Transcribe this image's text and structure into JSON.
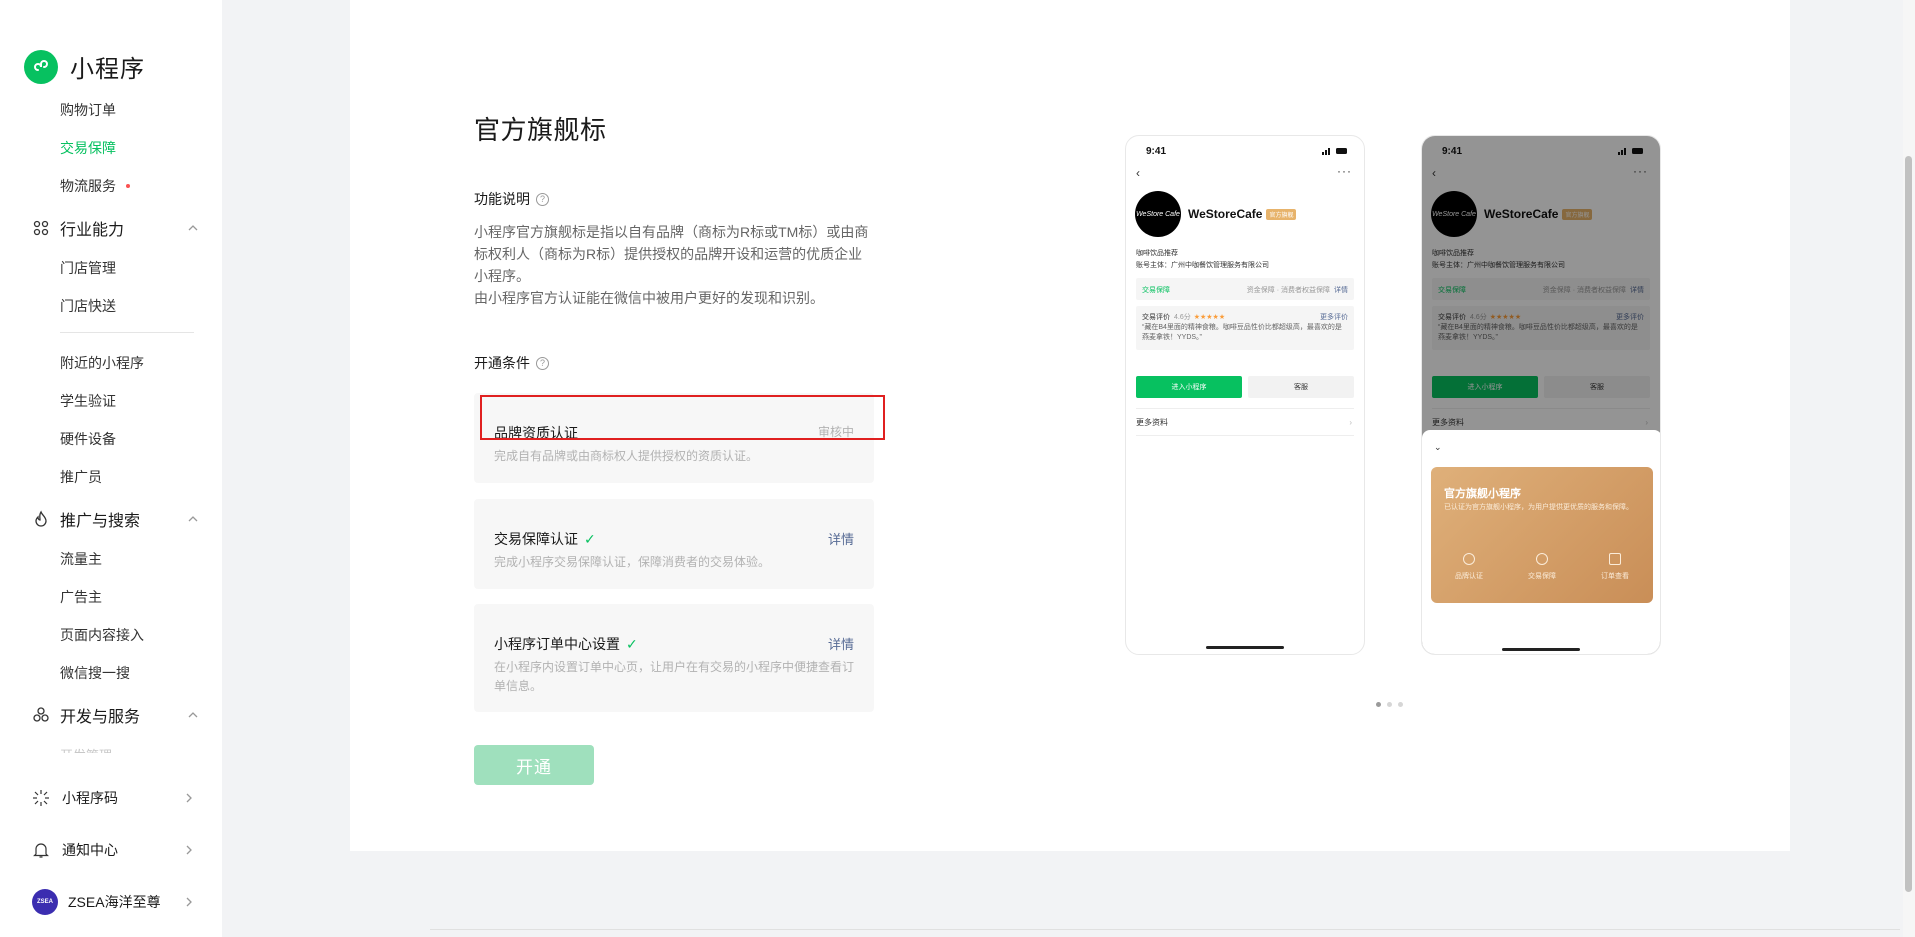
{
  "brand": {
    "title": "小程序"
  },
  "sidebar": {
    "top_items": [
      {
        "label": "购物订单",
        "active": false
      },
      {
        "label": "交易保障",
        "active": true
      },
      {
        "label": "物流服务",
        "active": false,
        "dot": true
      }
    ],
    "group_industry": {
      "label": "行业能力",
      "items": [
        "门店管理",
        "门店快送",
        "附近的小程序",
        "学生验证",
        "硬件设备",
        "推广员"
      ]
    },
    "group_promo": {
      "label": "推广与搜索",
      "items": [
        "流量主",
        "广告主",
        "页面内容接入",
        "微信搜一搜"
      ]
    },
    "group_dev": {
      "label": "开发与服务",
      "faded_item": "开发管理"
    },
    "bottom": {
      "qrcode": "小程序码",
      "notify": "通知中心",
      "account": "ZSEA海洋至尊",
      "avatar_text": "ZSEA"
    }
  },
  "main": {
    "title": "官方旗舰标",
    "feature_label": "功能说明",
    "feature_desc": [
      "小程序官方旗舰标是指以自有品牌（商标为R标或TM标）或由商标权利人（商标为R标）提供授权的品牌开设和运营的优质企业小程序。",
      "由小程序官方认证能在微信中被用户更好的发现和识别。"
    ],
    "conditions_label": "开通条件",
    "conditions": [
      {
        "title": "品牌资质认证",
        "status": "审核中",
        "desc": "完成自有品牌或由商标权人提供授权的资质认证。"
      },
      {
        "title": "交易保障认证",
        "check": "✓",
        "link": "详情",
        "desc": "完成小程序交易保障认证，保障消费者的交易体验。"
      },
      {
        "title": "小程序订单中心设置",
        "check": "✓",
        "link": "详情",
        "desc": "在小程序内设置订单中心页，让用户在有交易的小程序中便捷查看订单信息。"
      }
    ],
    "open_button": "开通"
  },
  "phone": {
    "time": "9:41",
    "name": "WeStoreCafe",
    "tag": "官方旗舰",
    "logo_text": "WeStore Cafe",
    "category": "咖啡饮品推荐",
    "owner": "账号主体：广州中咖餐饮管理服务有限公司",
    "guard_left": "交易保障",
    "guard_right": "资金保障 · 消费者权益保障",
    "guard_link": "详情",
    "review_label": "交易评价",
    "review_score": "4.6分",
    "review_stars": "★★★★★",
    "review_more": "更多评价",
    "review_text": "“藏在B4里面的精神食粮。咖啡豆品性价比都超级高，最喜欢的是燕麦拿铁！YYDS。”",
    "btn_enter": "进入小程序",
    "btn_service": "客服",
    "more_info": "更多资料",
    "sheet_title": "官方旗舰小程序",
    "sheet_desc": "已认证为官方旗舰小程序，为用户提供更优质的服务和保障。",
    "sheet_features": [
      "品牌认证",
      "交易保障",
      "订单查看"
    ]
  },
  "colors": {
    "brand_green": "#07c160",
    "link_blue": "#576b95",
    "highlight_red": "#e02020",
    "gold": "#d9a56c"
  }
}
